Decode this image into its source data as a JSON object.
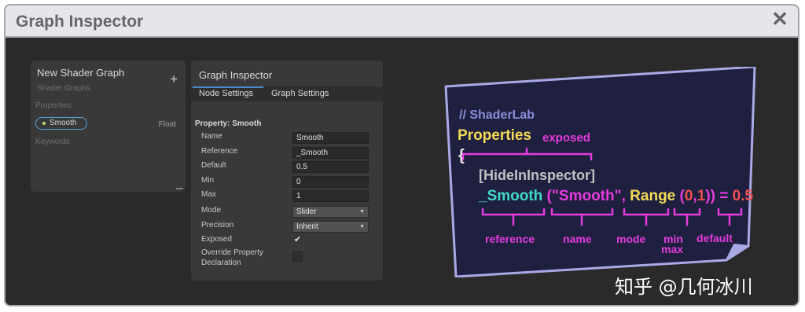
{
  "window": {
    "title": "Graph Inspector",
    "close_glyph": "✕"
  },
  "blackboard": {
    "title": "New Shader Graph",
    "subtitle": "Shader Graphs",
    "add_glyph": "+",
    "properties_label": "Properties",
    "property": {
      "name": "Smooth",
      "type": "Float"
    },
    "keywords_label": "Keywords"
  },
  "inspector": {
    "title": "Graph Inspector",
    "tabs": [
      {
        "label": "Node Settings"
      },
      {
        "label": "Graph Settings"
      }
    ],
    "property_header": "Property: Smooth",
    "rows": {
      "name": {
        "label": "Name",
        "value": "Smooth"
      },
      "reference": {
        "label": "Reference",
        "value": "_Smooth"
      },
      "default": {
        "label": "Default",
        "value": "0.5"
      },
      "min": {
        "label": "Min",
        "value": "0"
      },
      "max": {
        "label": "Max",
        "value": "1"
      },
      "mode": {
        "label": "Mode",
        "value": "Slider"
      },
      "precision": {
        "label": "Precision",
        "value": "Inherit"
      },
      "exposed": {
        "label": "Exposed",
        "checked": true
      },
      "override": {
        "label_line1": "Override Property",
        "label_line2": "Declaration",
        "checked": false
      }
    }
  },
  "note": {
    "comment": "// ShaderLab",
    "properties_keyword": "Properties",
    "open_brace": "{",
    "exposed_label": "exposed",
    "hide_attr": "[HideInInspector]",
    "code": {
      "ref": "_Smooth",
      "paren_open": " (",
      "name_str": "\"Smooth\"",
      "comma": ",",
      "range_kw": " Range",
      "range_open": " (",
      "min": "0",
      "range_comma": ",",
      "max": "1",
      "close": "))",
      "equals": " = ",
      "default": "0.5"
    },
    "labels": {
      "reference": "reference",
      "name": "name",
      "mode": "mode",
      "min": "min",
      "max": "max",
      "default": "default"
    },
    "colors": {
      "background": "#1f2040",
      "border": "#a9a9e6",
      "magenta": "#e63bde",
      "cyan": "#3fd9c6",
      "yellow": "#f5da57",
      "red": "#ef4f4f",
      "comment": "#8a8cd8"
    }
  },
  "watermark": "知乎 @几何冰川"
}
